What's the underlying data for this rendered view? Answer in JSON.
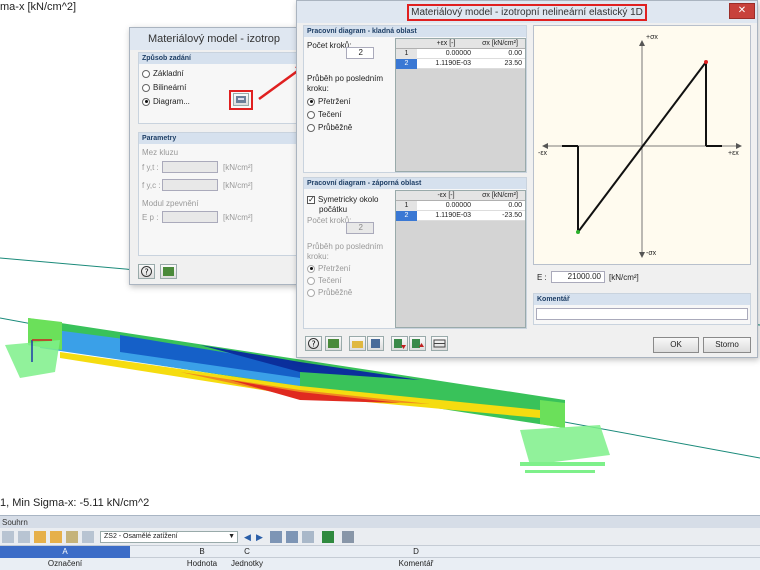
{
  "viewport": {
    "top_label": "ma-x [kN/cm^2]",
    "bottom_label": "1, Min Sigma-x: -5.11 kN/cm^2"
  },
  "bg_dialog": {
    "title": "Materiálový model - izotrop",
    "group1_title": "Způsob zadání",
    "opt1": "Základní",
    "opt2": "Bilineární",
    "opt3": "Diagram...",
    "group2_title": "Parametry",
    "mez_label": "Mez kluzu",
    "fy1": "f y,t :",
    "fy2": "f y,c :",
    "unit1": "[kN/cm²]",
    "unit2": "[kN/cm²]",
    "modul_label": "Modul zpevnění",
    "ep": "E p :",
    "unit3": "[kN/cm²]"
  },
  "dialog": {
    "title": "Materiálový model - izotropní nelineární elastický 1D",
    "pos": {
      "group_title": "Pracovní diagram - kladná oblast",
      "steps_label": "Počet kroků:",
      "steps_value": "2",
      "after_label_1": "Průběh po posledním",
      "after_label_2": "kroku:",
      "r1": "Přetržení",
      "r2": "Tečení",
      "r3": "Průběžně",
      "col_eps": "+εx [-]",
      "col_sig": "σx [kN/cm²]",
      "rows": [
        {
          "n": "1",
          "eps": "0.00000",
          "sig": "0.00"
        },
        {
          "n": "2",
          "eps": "1.1190E-03",
          "sig": "23.50"
        }
      ]
    },
    "neg": {
      "group_title": "Pracovní diagram - záporná oblast",
      "sym_label_1": "Symetricky okolo",
      "sym_label_2": "počátku",
      "steps_label": "Počet kroků:",
      "steps_value": "2",
      "after_label_1": "Průběh po posledním",
      "after_label_2": "kroku:",
      "r1": "Přetržení",
      "r2": "Tečení",
      "r3": "Průběžně",
      "col_eps": "-εx [-]",
      "col_sig": "σx [kN/cm²]",
      "rows": [
        {
          "n": "1",
          "eps": "0.00000",
          "sig": "0.00"
        },
        {
          "n": "2",
          "eps": "1.1190E-03",
          "sig": "-23.50"
        }
      ]
    },
    "diagram": {
      "top_axis": "+σx",
      "bottom_axis": "-σx",
      "left_axis": "-εx",
      "right_axis": "+εx"
    },
    "e_label": "E :",
    "e_value": "21000.00",
    "e_unit": "[kN/cm²]",
    "comment_title": "Komentář",
    "ok": "OK",
    "cancel": "Storno"
  },
  "bottom_panel": {
    "title": "Souhrn",
    "load_case": "ZS2 - Osamělé zatížení",
    "columns": [
      {
        "letter": "A",
        "name": "Označení"
      },
      {
        "letter": "B",
        "name": "Hodnota"
      },
      {
        "letter": "C",
        "name": "Jednotky"
      },
      {
        "letter": "D",
        "name": "Komentář"
      }
    ]
  },
  "colors": {
    "highlight_red": "#e02020",
    "title_blue": "#1e3f66",
    "selected_row": "#3a78d4"
  }
}
